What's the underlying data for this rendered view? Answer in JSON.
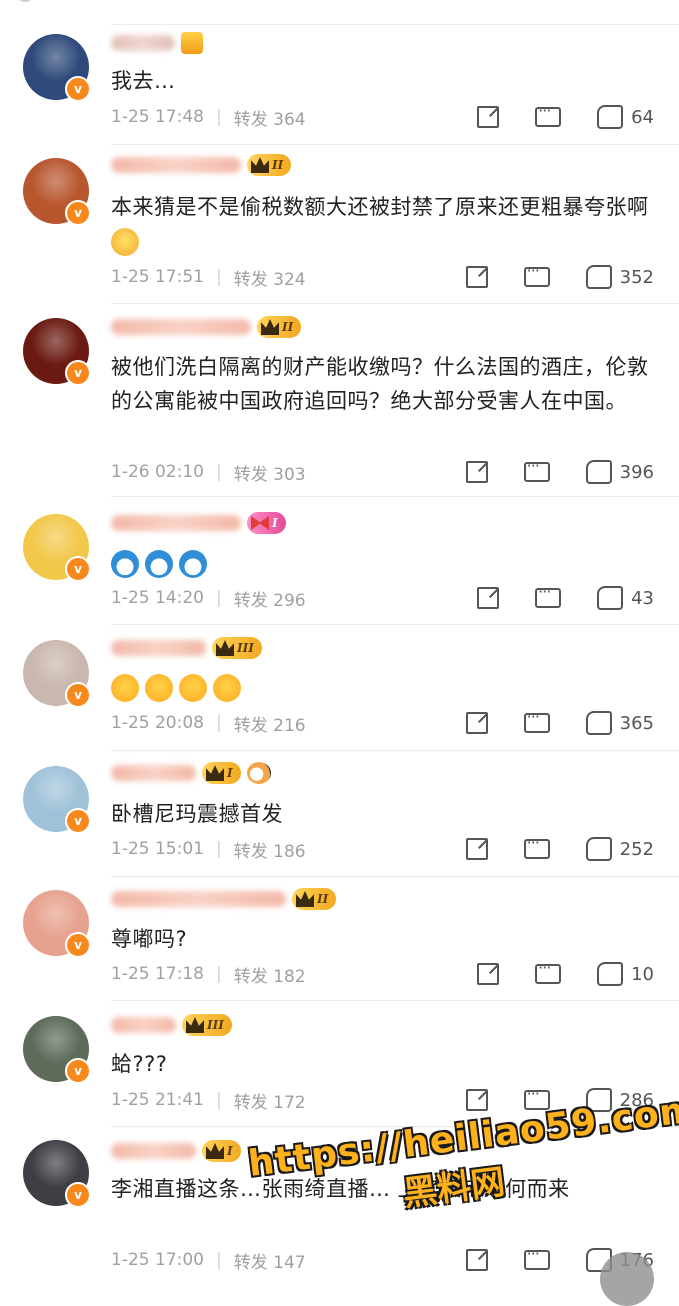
{
  "colors": {
    "accent_orange": "#f7891c",
    "meta_grey": "#a0a0a0",
    "text": "#222222",
    "watermark": "#ffb11b"
  },
  "icons": {
    "share": "share-icon",
    "comment": "comment-icon",
    "like": "like-icon",
    "verified": "verified-badge-icon"
  },
  "comments": [
    {
      "text": "我去…",
      "time": "1-25 17:48",
      "repost": "转发 364",
      "likes": "64",
      "vip": "",
      "extra": "gift",
      "avatar_bg": "#2f4a7a"
    },
    {
      "text": "本来猜是不是偷税数额大还被封禁了原来还更粗暴夸张啊",
      "emoji": "shock",
      "time": "1-25 17:51",
      "repost": "转发 324",
      "likes": "352",
      "vip": "II",
      "avatar_bg": "#b8562e"
    },
    {
      "text": "被他们洗白隔离的财产能收缴吗？什么法国的酒庄，伦敦的公寓能被中国政府追回吗？绝大部分受害人在中国。",
      "time": "1-26 02:10",
      "repost": "转发 303",
      "likes": "396",
      "vip": "II",
      "avatar_bg": "#6a1a12"
    },
    {
      "text": "",
      "emoji_row": "dora3",
      "time": "1-25 14:20",
      "repost": "转发 296",
      "likes": "43",
      "vip": "I",
      "vip_style": "pink",
      "avatar_bg": "#f2c84b"
    },
    {
      "text": "",
      "emoji_row": "face4",
      "time": "1-25 20:08",
      "repost": "转发 216",
      "likes": "365",
      "vip": "III",
      "avatar_bg": "#c9b8ae"
    },
    {
      "text": "卧槽尼玛震撼首发",
      "time": "1-25 15:01",
      "repost": "转发 186",
      "likes": "252",
      "vip": "I",
      "extra": "cat",
      "avatar_bg": "#9fc2d8"
    },
    {
      "text": "尊嘟吗?",
      "time": "1-25 17:18",
      "repost": "转发 182",
      "likes": "10",
      "vip": "II",
      "avatar_bg": "#e7a28f"
    },
    {
      "text": "蛤???",
      "time": "1-25 21:41",
      "repost": "转发 172",
      "likes": "286",
      "vip": "III",
      "avatar_bg": "#5e6a5a"
    },
    {
      "text": "李湘直播这条…张雨绮直播… 上亿豪宅从何而来",
      "time": "1-25 17:00",
      "repost": "转发 147",
      "likes": "176",
      "vip": "I",
      "avatar_bg": "#3e3f45"
    }
  ],
  "watermark": {
    "line1": "https://heiliao59.com",
    "line2": "黑料网"
  }
}
